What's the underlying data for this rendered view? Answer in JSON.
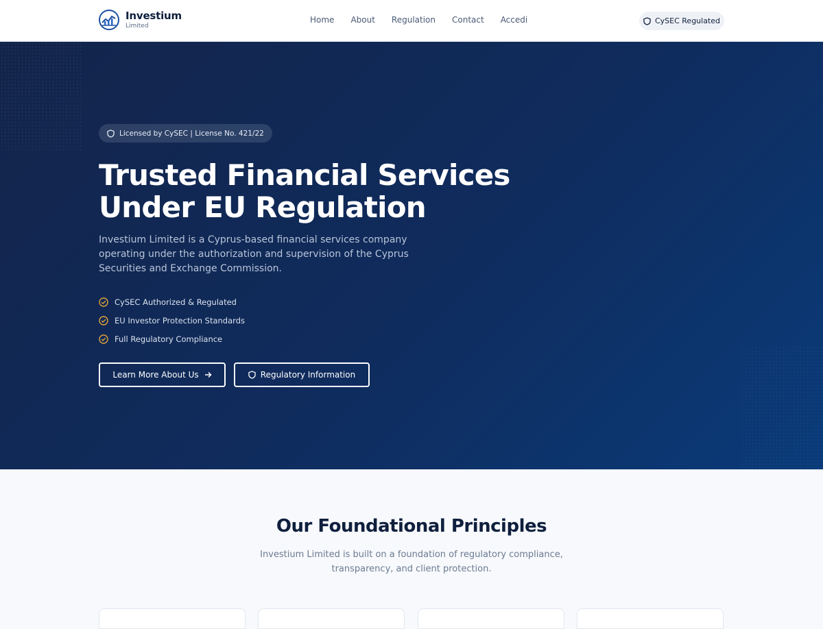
{
  "header": {
    "brand_name": "Investium",
    "brand_sub": "Limited",
    "nav": [
      "Home",
      "About",
      "Regulation",
      "Contact",
      "Accedi"
    ],
    "badge": "CySEC Regulated"
  },
  "hero": {
    "license_badge": "Licensed by CySEC | License No. 421/22",
    "title_line1": "Trusted Financial Services",
    "title_line2": "Under EU Regulation",
    "description": "Investium Limited is a Cyprus-based financial services company operating under the authorization and supervision of the Cyprus Securities and Exchange Commission.",
    "features": [
      "CySEC Authorized & Regulated",
      "EU Investor Protection Standards",
      "Full Regulatory Compliance"
    ],
    "primary_button": "Learn More About Us",
    "secondary_button": "Regulatory Information"
  },
  "principles": {
    "title": "Our Foundational Principles",
    "subtitle": "Investium Limited is built on a foundation of regulatory compliance, transparency, and client protection."
  },
  "icons": {
    "logo": "globe-chart-logo",
    "shield": "shield-icon",
    "check": "check-circle-icon",
    "arrow": "arrow-right-icon"
  },
  "colors": {
    "hero_bg_start": "#13244a",
    "hero_bg_end": "#0a3b79",
    "accent_check": "#e0a43a",
    "brand_blue": "#1a4fa0"
  }
}
